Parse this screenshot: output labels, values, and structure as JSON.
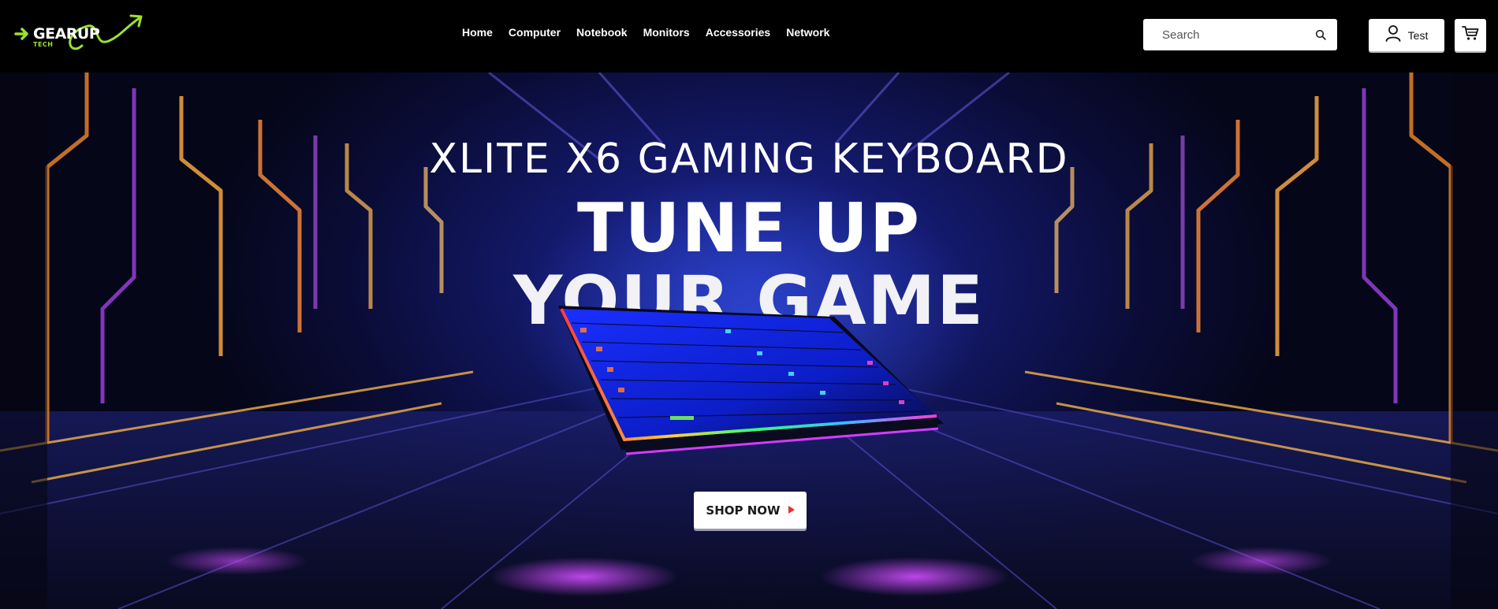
{
  "brand": {
    "name": "GEARUP",
    "sub": "TECH",
    "accent": "#9be22d"
  },
  "nav": {
    "items": [
      {
        "label": "Home"
      },
      {
        "label": "Computer"
      },
      {
        "label": "Notebook"
      },
      {
        "label": "Monitors"
      },
      {
        "label": "Accessories"
      },
      {
        "label": "Network"
      }
    ]
  },
  "search": {
    "placeholder": "Search",
    "value": "",
    "icon": "search-icon"
  },
  "account": {
    "label": "Test",
    "icon": "user-icon"
  },
  "cart": {
    "icon": "cart-icon"
  },
  "hero": {
    "kicker": "XLITE X6 GAMING KEYBOARD",
    "headline_line1": "TUNE UP",
    "headline_line2": "YOUR GAME",
    "cta_label": "SHOP NOW",
    "cta_icon": "play-arrow-icon",
    "cta_arrow_color": "#e2342b",
    "background_color": "#141a6e",
    "neon_color_1": "#f08a2a",
    "neon_color_2": "#b43cff"
  }
}
